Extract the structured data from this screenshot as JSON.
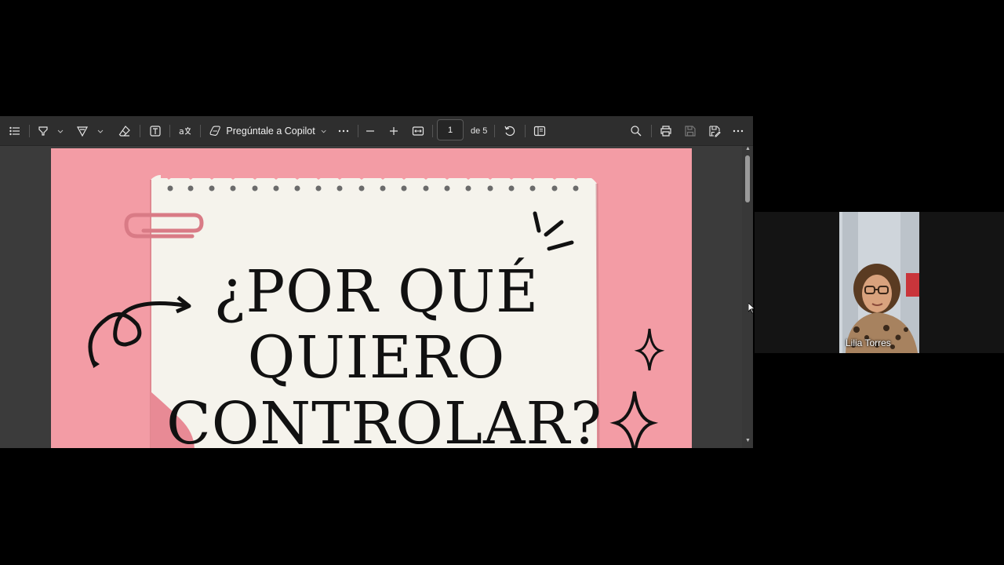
{
  "toolbar": {
    "icons": [
      "contents-icon",
      "highlight-icon",
      "draw-icon",
      "eraser-icon",
      "text-icon",
      "read-aloud-icon",
      "copilot-icon",
      "more-icon",
      "zoom-out-icon",
      "zoom-in-icon",
      "fit-page-icon",
      "rotate-icon",
      "page-view-icon",
      "search-icon",
      "print-icon",
      "save-icon",
      "save-as-icon",
      "settings-more-icon"
    ],
    "copilot_label": "Pregúntale a Copilot",
    "page_current": "1",
    "page_of": "de 5"
  },
  "slide": {
    "title_lines": [
      "¿POR QUÉ",
      "QUIERO",
      "CONTROLAR?"
    ],
    "colors": {
      "background": "#f39ca5",
      "paper": "#f5f3ec",
      "ink": "#111111"
    }
  },
  "participant": {
    "name": "Lilia Torres"
  }
}
